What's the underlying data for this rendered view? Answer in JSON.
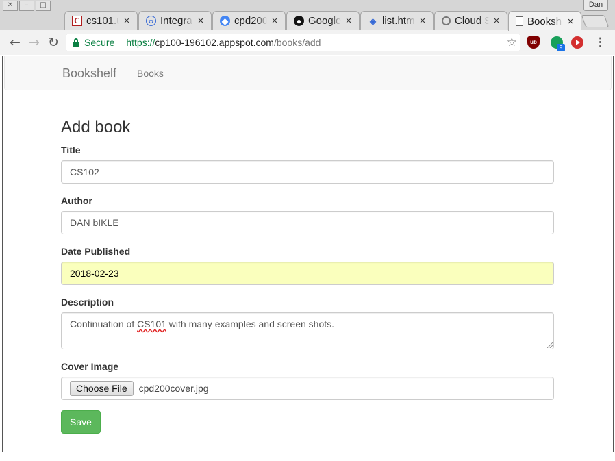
{
  "browser": {
    "profile_name": "Dan",
    "tabs": [
      {
        "title": "cs101.u",
        "icon": "c-letter-icon",
        "active": false
      },
      {
        "title": "Integra",
        "icon": "integration-icon",
        "active": false
      },
      {
        "title": "cpd200",
        "icon": "cloud-endpoints-icon",
        "active": false
      },
      {
        "title": "Google",
        "icon": "github-icon",
        "active": false
      },
      {
        "title": "list.htm",
        "icon": "code-icon",
        "active": false
      },
      {
        "title": "Cloud S",
        "icon": "gear-icon",
        "active": false
      },
      {
        "title": "Booksh",
        "icon": "page-icon",
        "active": true
      }
    ],
    "close_glyph": "×",
    "secure_label": "Secure",
    "url": {
      "scheme": "https://",
      "host": "cp100-196102.appspot.com",
      "path": "/books/add"
    },
    "extension_badge": "9",
    "extension_ub_label": "ub"
  },
  "navbar": {
    "brand": "Bookshelf",
    "link": "Books"
  },
  "form": {
    "heading": "Add book",
    "title_label": "Title",
    "title_value": "CS102",
    "author_label": "Author",
    "author_value": "DAN bIKLE",
    "date_label": "Date Published",
    "date_value": "2018-02-23",
    "description_label": "Description",
    "description_before": "Continuation of ",
    "description_spell": "CS101",
    "description_after": " with many examples and screen shots.",
    "cover_label": "Cover Image",
    "choose_file_label": "Choose File",
    "file_name": "cpd200cover.jpg",
    "save_label": "Save"
  },
  "colors": {
    "secure_green": "#0b8043",
    "autofill_yellow": "#faffbd",
    "save_green": "#5cb85c"
  }
}
